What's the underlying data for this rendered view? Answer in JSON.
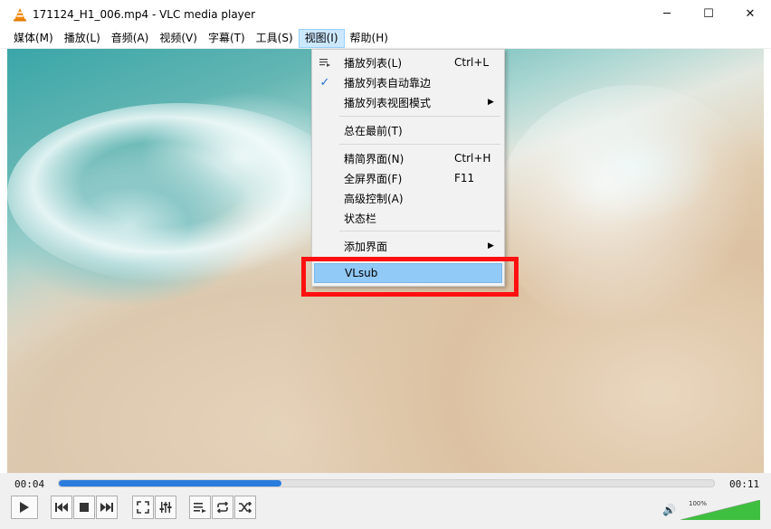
{
  "window": {
    "title": "171124_H1_006.mp4 - VLC media player",
    "controls": {
      "minimize": "─",
      "maximize": "☐",
      "close": "✕"
    }
  },
  "menubar": {
    "items": [
      {
        "label": "媒体(M)"
      },
      {
        "label": "播放(L)"
      },
      {
        "label": "音频(A)"
      },
      {
        "label": "视频(V)"
      },
      {
        "label": "字幕(T)"
      },
      {
        "label": "工具(S)"
      },
      {
        "label": "视图(I)",
        "active": true
      },
      {
        "label": "帮助(H)"
      }
    ]
  },
  "view_menu": {
    "items": [
      {
        "label": "播放列表(L)",
        "shortcut": "Ctrl+L",
        "icon": "playlist-icon"
      },
      {
        "label": "播放列表自动靠边",
        "checked": true
      },
      {
        "label": "播放列表视图模式",
        "submenu": true
      },
      {
        "label": "总在最前(T)"
      },
      {
        "label": "精简界面(N)",
        "shortcut": "Ctrl+H"
      },
      {
        "label": "全屏界面(F)",
        "shortcut": "F11"
      },
      {
        "label": "高级控制(A)"
      },
      {
        "label": "状态栏"
      },
      {
        "label": "添加界面",
        "submenu": true
      },
      {
        "label": "VLsub",
        "highlighted": true
      }
    ]
  },
  "playback": {
    "elapsed": "00:04",
    "total": "00:11",
    "progress_fraction": 0.34,
    "volume_label": "100%",
    "volume_fraction": 1.0
  },
  "colors": {
    "highlight": "#91c9f7",
    "annotation_box": "#ff1010",
    "seek_fill": "#2a7cdc",
    "volume_fill": "#3fbf3f"
  }
}
